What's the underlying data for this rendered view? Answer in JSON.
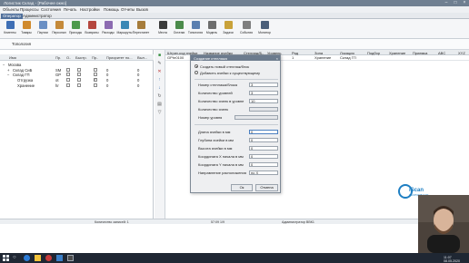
{
  "titlebar": {
    "title": "Логистик Склад - [Рабочее окно]"
  },
  "menu": [
    "Объекты",
    "Процессы",
    "Состояния",
    "Печать",
    "Настройки",
    "Помощь",
    "Отчеты",
    "Вызов"
  ],
  "roles": [
    "Оператор",
    "Администратор"
  ],
  "ribbon": [
    {
      "label": "Клиенты",
      "icon": "clients-icon",
      "color": "#3f6fb5"
    },
    {
      "label": "Товары",
      "icon": "goods-icon",
      "color": "#d08a2e"
    },
    {
      "label": "Партии",
      "icon": "batches-icon",
      "color": "#6a8fc4"
    },
    {
      "label": "Персонал",
      "icon": "staff-icon",
      "color": "#c58a3a"
    },
    {
      "label": "Приходы",
      "icon": "receipts-icon",
      "color": "#4d9a4d"
    },
    {
      "label": "Возвраты",
      "icon": "returns-icon",
      "color": "#b5473f"
    },
    {
      "label": "Расходы",
      "icon": "shipments-icon",
      "color": "#8c6bb1"
    },
    {
      "label": "Маршруты",
      "icon": "routes-icon",
      "color": "#3a88b5"
    },
    {
      "label": "Перестанет",
      "icon": "relocation-icon",
      "color": "#a67c3b"
    },
    {
      "label": "Места",
      "icon": "locations-icon",
      "color": "#3b3b3b"
    },
    {
      "label": "Остатки",
      "icon": "stock-icon",
      "color": "#4b8b4b"
    },
    {
      "label": "Топология",
      "icon": "topology-icon",
      "color": "#5a7fb0"
    },
    {
      "label": "Модель",
      "icon": "model-icon",
      "color": "#6d6d6d"
    },
    {
      "label": "Задачи",
      "icon": "tasks-icon",
      "color": "#c9a23a"
    },
    {
      "label": "События",
      "icon": "events-icon",
      "color": "#7f7f7f"
    },
    {
      "label": "Монитор",
      "icon": "monitor-icon",
      "color": "#4a5f7a"
    }
  ],
  "subtab": "Топология",
  "tree": {
    "headers": [
      "Имя",
      "Пр.",
      "О..",
      "Быстр.",
      "Пр..",
      "Приоритет по...",
      "Выл..."
    ],
    "rows": [
      {
        "indent": 0,
        "name": "Москва",
        "code": "",
        "c1": "",
        "c2": "",
        "n1": "",
        "n2": "",
        "n3": "",
        "expander": "−"
      },
      {
        "indent": 1,
        "name": "Склад СиБ",
        "code": "SM",
        "c1": "",
        "c2": "",
        "n1": "0",
        "n2": "0",
        "n3": "",
        "expander": "+"
      },
      {
        "indent": 1,
        "name": "Склад ГП",
        "code": "GP",
        "c1": "",
        "c2": "",
        "n1": "0",
        "n2": "0",
        "n3": "",
        "expander": "−"
      },
      {
        "indent": 2,
        "name": "Отгрузка",
        "code": "ot",
        "c1": "",
        "c2": "",
        "n1": "0",
        "n2": "0",
        "n3": "",
        "expander": ""
      },
      {
        "indent": 2,
        "name": "Хранение",
        "code": "hr",
        "c1": "",
        "c2": "",
        "n1": "0",
        "n2": "0",
        "n3": "",
        "expander": ""
      }
    ]
  },
  "grid": {
    "headers": [
      "Штрих-код ячейки",
      "Название ячейки",
      "Стеллаж/Б..",
      "Уровень",
      "Ряд",
      "Зона",
      "Локация",
      "Подбор",
      "Хранение",
      "Приемка",
      "ABC",
      "XYZ"
    ],
    "rows": [
      {
        "barcode": "GPhr0100",
        "name": "",
        "rack": "",
        "level": "",
        "row": "1",
        "zone": "Хранение",
        "location": "Склад ГП",
        "pick": "",
        "store": "",
        "accept": "",
        "abc": "",
        "xyz": ""
      }
    ]
  },
  "dialog": {
    "title": "Создание стеллажа",
    "close": "×",
    "opt_new": "Создать новый стеллаж/блок",
    "opt_add": "Добавить ячейки к существующему",
    "rack_number_label": "Номер стеллажа/блока",
    "rack_number": "3",
    "levels_label": "Количество уровней",
    "levels": "3",
    "cells_label": "Количество ячеек в уровне",
    "cells": "10",
    "cells_count_label": "Количество ячеек",
    "cells_count": "",
    "level_number_label": "Номер уровня",
    "level_number": "",
    "length_label": "Длина ячейки в мм",
    "length": "0",
    "depth_label": "Глубина ячейки в мм",
    "depth": "0",
    "height_label": "Высота ячейки в мм",
    "height": "0",
    "coord_x_label": "Координата Х начала в мм",
    "coord_x": "0",
    "coord_y_label": "Координата Y начала в мм",
    "coord_y": "0",
    "direction_label": "Направление расположения",
    "direction": "по X",
    "ok": "Ок",
    "cancel": "Отмена"
  },
  "status": {
    "left": "Количество записей: 1",
    "middle": "57:09 1/9",
    "right": "Администратор ВВК1"
  },
  "logo": {
    "text": "iScan",
    "sub": "ОБОРУДОВАНИЕ"
  },
  "taskbar": {
    "time": "11:07",
    "date": "08.05.2020"
  }
}
